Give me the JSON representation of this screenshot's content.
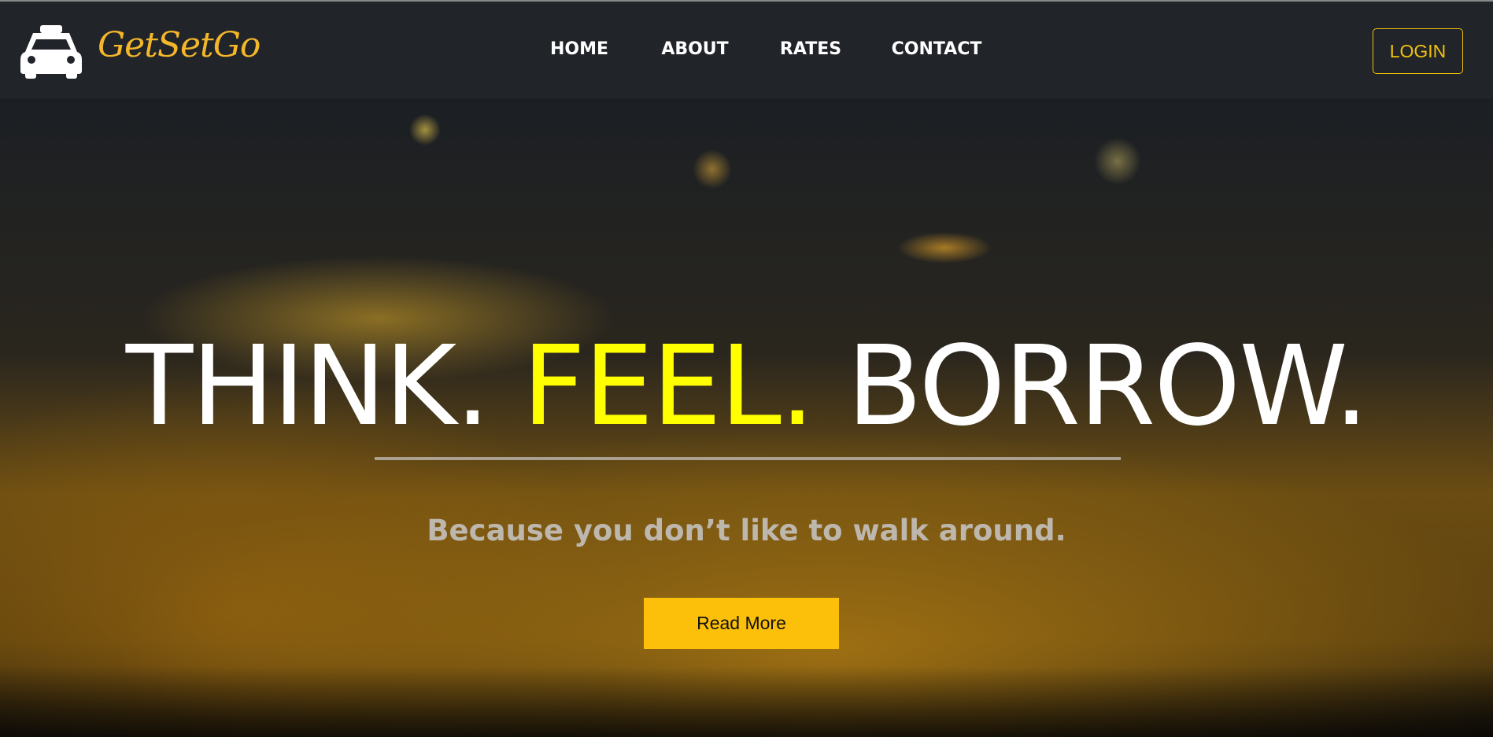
{
  "brand": {
    "name": "GetSetGo",
    "icon": "taxi-icon"
  },
  "nav": {
    "items": [
      {
        "label": "HOME"
      },
      {
        "label": "ABOUT"
      },
      {
        "label": "RATES"
      },
      {
        "label": "CONTACT"
      }
    ],
    "login_label": "LOGIN"
  },
  "hero": {
    "headline_1": "THINK.",
    "headline_2": "FEEL.",
    "headline_3": "BORROW.",
    "subtitle": "Because you don’t like to walk around.",
    "button_label": "Read More"
  },
  "colors": {
    "nav_bg": "#212429",
    "accent": "#fcc00b",
    "brand": "#f5b72a",
    "highlight": "#ffff00"
  }
}
